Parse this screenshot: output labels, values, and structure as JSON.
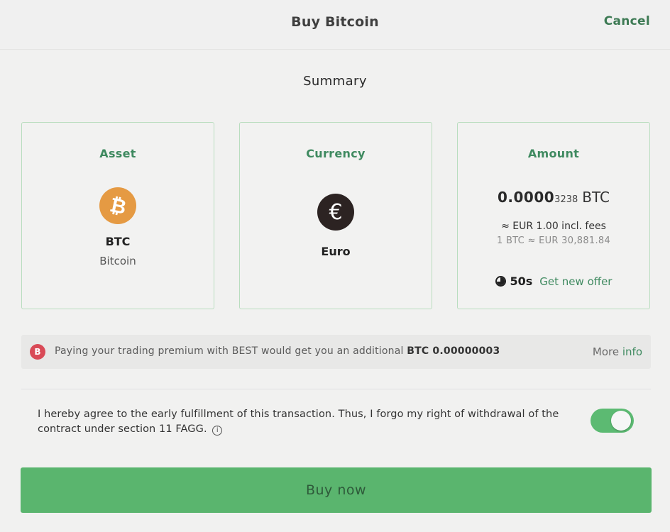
{
  "header": {
    "title": "Buy Bitcoin",
    "cancel_label": "Cancel"
  },
  "summary": {
    "title": "Summary"
  },
  "cards": {
    "asset": {
      "label": "Asset",
      "icon": "bitcoin-icon",
      "icon_glyph": "₿",
      "icon_color": "#e59a43",
      "symbol": "BTC",
      "name": "Bitcoin"
    },
    "currency": {
      "label": "Currency",
      "icon": "euro-icon",
      "icon_glyph": "€",
      "icon_color": "#2c2322",
      "name": "Euro"
    },
    "amount": {
      "label": "Amount",
      "value_main": "0.0000",
      "value_small": "3238",
      "unit": "BTC",
      "fee_text": "≈ EUR 1.00 incl. fees",
      "rate_text": "1 BTC ≈ EUR 30,881.84",
      "timer": "50s",
      "new_offer_label": "Get new offer"
    }
  },
  "premium": {
    "icon": "best-token-icon",
    "icon_glyph": "B",
    "text": "Paying your trading premium with BEST would get you an additional",
    "bonus": "BTC 0.00000003",
    "more_label": "More",
    "info_label": "info"
  },
  "agreement": {
    "text": "I hereby agree to the early fulfillment of this transaction. Thus, I forgo my right of withdrawal of the contract under section 11 FAGG.",
    "info_glyph": "i",
    "toggle_on": true
  },
  "buy_button": {
    "label": "Buy now"
  },
  "colors": {
    "accent_green": "#3f8a60",
    "button_green": "#5ab56e",
    "toggle_green": "#5cba72",
    "card_border": "#b9ddbf",
    "best_red": "#d94a57"
  }
}
